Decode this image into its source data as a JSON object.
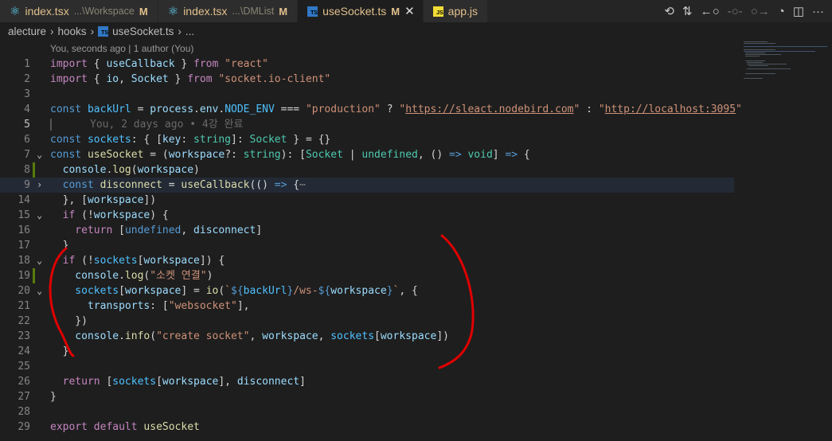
{
  "tabs": [
    {
      "name": "index.tsx",
      "desc": "...\\Workspace",
      "status": "M",
      "icon": "react-icon"
    },
    {
      "name": "index.tsx",
      "desc": "...\\DMList",
      "status": "M",
      "icon": "react-icon"
    },
    {
      "name": "useSocket.ts",
      "desc": "",
      "status": "M",
      "icon": "ts-icon",
      "active": true
    },
    {
      "name": "app.js",
      "desc": "",
      "status": "",
      "icon": "js-icon"
    }
  ],
  "icons": {
    "ts": "TS",
    "js": "JS",
    "react": "⚛",
    "close": "✕",
    "more": "···",
    "chev": "›"
  },
  "breadcrumb": [
    "alecture",
    "hooks",
    "useSocket.ts",
    "..."
  ],
  "blame_header": "You, seconds ago | 1 author (You)",
  "blame_inline": "You, 2 days ago • 4강 완료",
  "colors": {
    "annotation": "#e00000",
    "modified_gutter": "#587c0c"
  },
  "lines": [
    {
      "n": "1",
      "t": [
        [
          "import",
          "c"
        ],
        [
          " { ",
          "p"
        ],
        [
          "useCallback",
          "v"
        ],
        [
          " } ",
          "p"
        ],
        [
          "from",
          "c"
        ],
        [
          " ",
          "p"
        ],
        [
          "\"react\"",
          "s"
        ]
      ]
    },
    {
      "n": "2",
      "t": [
        [
          "import",
          "c"
        ],
        [
          " { ",
          "p"
        ],
        [
          "io",
          "v"
        ],
        [
          ", ",
          "p"
        ],
        [
          "Socket",
          "v"
        ],
        [
          " } ",
          "p"
        ],
        [
          "from",
          "c"
        ],
        [
          " ",
          "p"
        ],
        [
          "\"socket.io-client\"",
          "s"
        ]
      ]
    },
    {
      "n": "3",
      "t": []
    },
    {
      "n": "4",
      "t": [
        [
          "const",
          "k"
        ],
        [
          " ",
          "p"
        ],
        [
          "backUrl",
          "n"
        ],
        [
          " = ",
          "p"
        ],
        [
          "process",
          "v"
        ],
        [
          ".",
          "p"
        ],
        [
          "env",
          "v"
        ],
        [
          ".",
          "p"
        ],
        [
          "NODE_ENV",
          "n"
        ],
        [
          " === ",
          "p"
        ],
        [
          "\"production\"",
          "s"
        ],
        [
          " ? ",
          "p"
        ],
        [
          "\"",
          "s"
        ],
        [
          "https://sleact.nodebird.com",
          "su"
        ],
        [
          "\"",
          "s"
        ],
        [
          " : ",
          "p"
        ],
        [
          "\"",
          "s"
        ],
        [
          "http://localhost:3095",
          "su"
        ],
        [
          "\"",
          "s"
        ]
      ]
    },
    {
      "n": "5",
      "t": [],
      "blame": true
    },
    {
      "n": "6",
      "t": [
        [
          "const",
          "k"
        ],
        [
          " ",
          "p"
        ],
        [
          "sockets",
          "n"
        ],
        [
          ": { [",
          "p"
        ],
        [
          "key",
          "v"
        ],
        [
          ": ",
          "p"
        ],
        [
          "string",
          "t"
        ],
        [
          "]: ",
          "p"
        ],
        [
          "Socket",
          "t"
        ],
        [
          " } = {}",
          "p"
        ]
      ]
    },
    {
      "n": "7",
      "t": [
        [
          "const",
          "k"
        ],
        [
          " ",
          "p"
        ],
        [
          "useSocket",
          "f"
        ],
        [
          " = (",
          "p"
        ],
        [
          "workspace",
          "v"
        ],
        [
          "?: ",
          "p"
        ],
        [
          "string",
          "t"
        ],
        [
          "): [",
          "p"
        ],
        [
          "Socket",
          "t"
        ],
        [
          " | ",
          "p"
        ],
        [
          "undefined",
          "t"
        ],
        [
          ", () ",
          "p"
        ],
        [
          "=>",
          "k"
        ],
        [
          " ",
          "p"
        ],
        [
          "void",
          "t"
        ],
        [
          "] ",
          "p"
        ],
        [
          "=>",
          "k"
        ],
        [
          " {",
          "p"
        ]
      ],
      "fold": "v"
    },
    {
      "n": "8",
      "t": [
        [
          "  console",
          "v"
        ],
        [
          ".",
          "p"
        ],
        [
          "log",
          "f"
        ],
        [
          "(",
          "p"
        ],
        [
          "workspace",
          "v"
        ],
        [
          ")",
          "p"
        ]
      ],
      "mod": true
    },
    {
      "n": "9",
      "t": [
        [
          "  const",
          "k"
        ],
        [
          " ",
          "p"
        ],
        [
          "disconnect",
          "f"
        ],
        [
          " = ",
          "p"
        ],
        [
          "useCallback",
          "f"
        ],
        [
          "(() ",
          "p"
        ],
        [
          "=>",
          "k"
        ],
        [
          " {",
          "p"
        ],
        [
          "⋯",
          "b"
        ]
      ],
      "fold": ">",
      "hl": true
    },
    {
      "n": "14",
      "t": [
        [
          "  }, [",
          "p"
        ],
        [
          "workspace",
          "v"
        ],
        [
          "])",
          "p"
        ]
      ]
    },
    {
      "n": "15",
      "t": [
        [
          "  if",
          "c"
        ],
        [
          " (!",
          "p"
        ],
        [
          "workspace",
          "v"
        ],
        [
          ") {",
          "p"
        ]
      ],
      "fold": "v"
    },
    {
      "n": "16",
      "t": [
        [
          "    return",
          "c"
        ],
        [
          " [",
          "p"
        ],
        [
          "undefined",
          "k"
        ],
        [
          ", ",
          "p"
        ],
        [
          "disconnect",
          "v"
        ],
        [
          "]",
          "p"
        ]
      ]
    },
    {
      "n": "17",
      "t": [
        [
          "  }",
          "p"
        ]
      ]
    },
    {
      "n": "18",
      "t": [
        [
          "  if",
          "c"
        ],
        [
          " (!",
          "p"
        ],
        [
          "sockets",
          "n"
        ],
        [
          "[",
          "p"
        ],
        [
          "workspace",
          "v"
        ],
        [
          "]) {",
          "p"
        ]
      ],
      "fold": "v"
    },
    {
      "n": "19",
      "t": [
        [
          "    console",
          "v"
        ],
        [
          ".",
          "p"
        ],
        [
          "log",
          "f"
        ],
        [
          "(",
          "p"
        ],
        [
          "\"소켓 연결\"",
          "s"
        ],
        [
          ")",
          "p"
        ]
      ],
      "mod": true
    },
    {
      "n": "20",
      "t": [
        [
          "    sockets",
          "n"
        ],
        [
          "[",
          "p"
        ],
        [
          "workspace",
          "v"
        ],
        [
          "] = ",
          "p"
        ],
        [
          "io",
          "f"
        ],
        [
          "(",
          "p"
        ],
        [
          "`",
          "s"
        ],
        [
          "${",
          "k"
        ],
        [
          "backUrl",
          "n"
        ],
        [
          "}",
          "k"
        ],
        [
          "/ws-",
          "s"
        ],
        [
          "${",
          "k"
        ],
        [
          "workspace",
          "v"
        ],
        [
          "}",
          "k"
        ],
        [
          "`",
          "s"
        ],
        [
          ", {",
          "p"
        ]
      ],
      "fold": "v"
    },
    {
      "n": "21",
      "t": [
        [
          "      transports",
          "v"
        ],
        [
          ": [",
          "p"
        ],
        [
          "\"websocket\"",
          "s"
        ],
        [
          "],",
          "p"
        ]
      ]
    },
    {
      "n": "22",
      "t": [
        [
          "    })",
          "p"
        ]
      ]
    },
    {
      "n": "23",
      "t": [
        [
          "    console",
          "v"
        ],
        [
          ".",
          "p"
        ],
        [
          "info",
          "f"
        ],
        [
          "(",
          "p"
        ],
        [
          "\"create socket\"",
          "s"
        ],
        [
          ", ",
          "p"
        ],
        [
          "workspace",
          "v"
        ],
        [
          ", ",
          "p"
        ],
        [
          "sockets",
          "n"
        ],
        [
          "[",
          "p"
        ],
        [
          "workspace",
          "v"
        ],
        [
          "])",
          "p"
        ]
      ]
    },
    {
      "n": "24",
      "t": [
        [
          "  }",
          "p"
        ]
      ]
    },
    {
      "n": "25",
      "t": []
    },
    {
      "n": "26",
      "t": [
        [
          "  return",
          "c"
        ],
        [
          " [",
          "p"
        ],
        [
          "sockets",
          "n"
        ],
        [
          "[",
          "p"
        ],
        [
          "workspace",
          "v"
        ],
        [
          "], ",
          "p"
        ],
        [
          "disconnect",
          "v"
        ],
        [
          "]",
          "p"
        ]
      ]
    },
    {
      "n": "27",
      "t": [
        [
          "}",
          "p"
        ]
      ]
    },
    {
      "n": "28",
      "t": []
    },
    {
      "n": "29",
      "t": [
        [
          "export",
          "c"
        ],
        [
          " ",
          "p"
        ],
        [
          "default",
          "c"
        ],
        [
          " ",
          "p"
        ],
        [
          "useSocket",
          "f"
        ]
      ]
    }
  ]
}
